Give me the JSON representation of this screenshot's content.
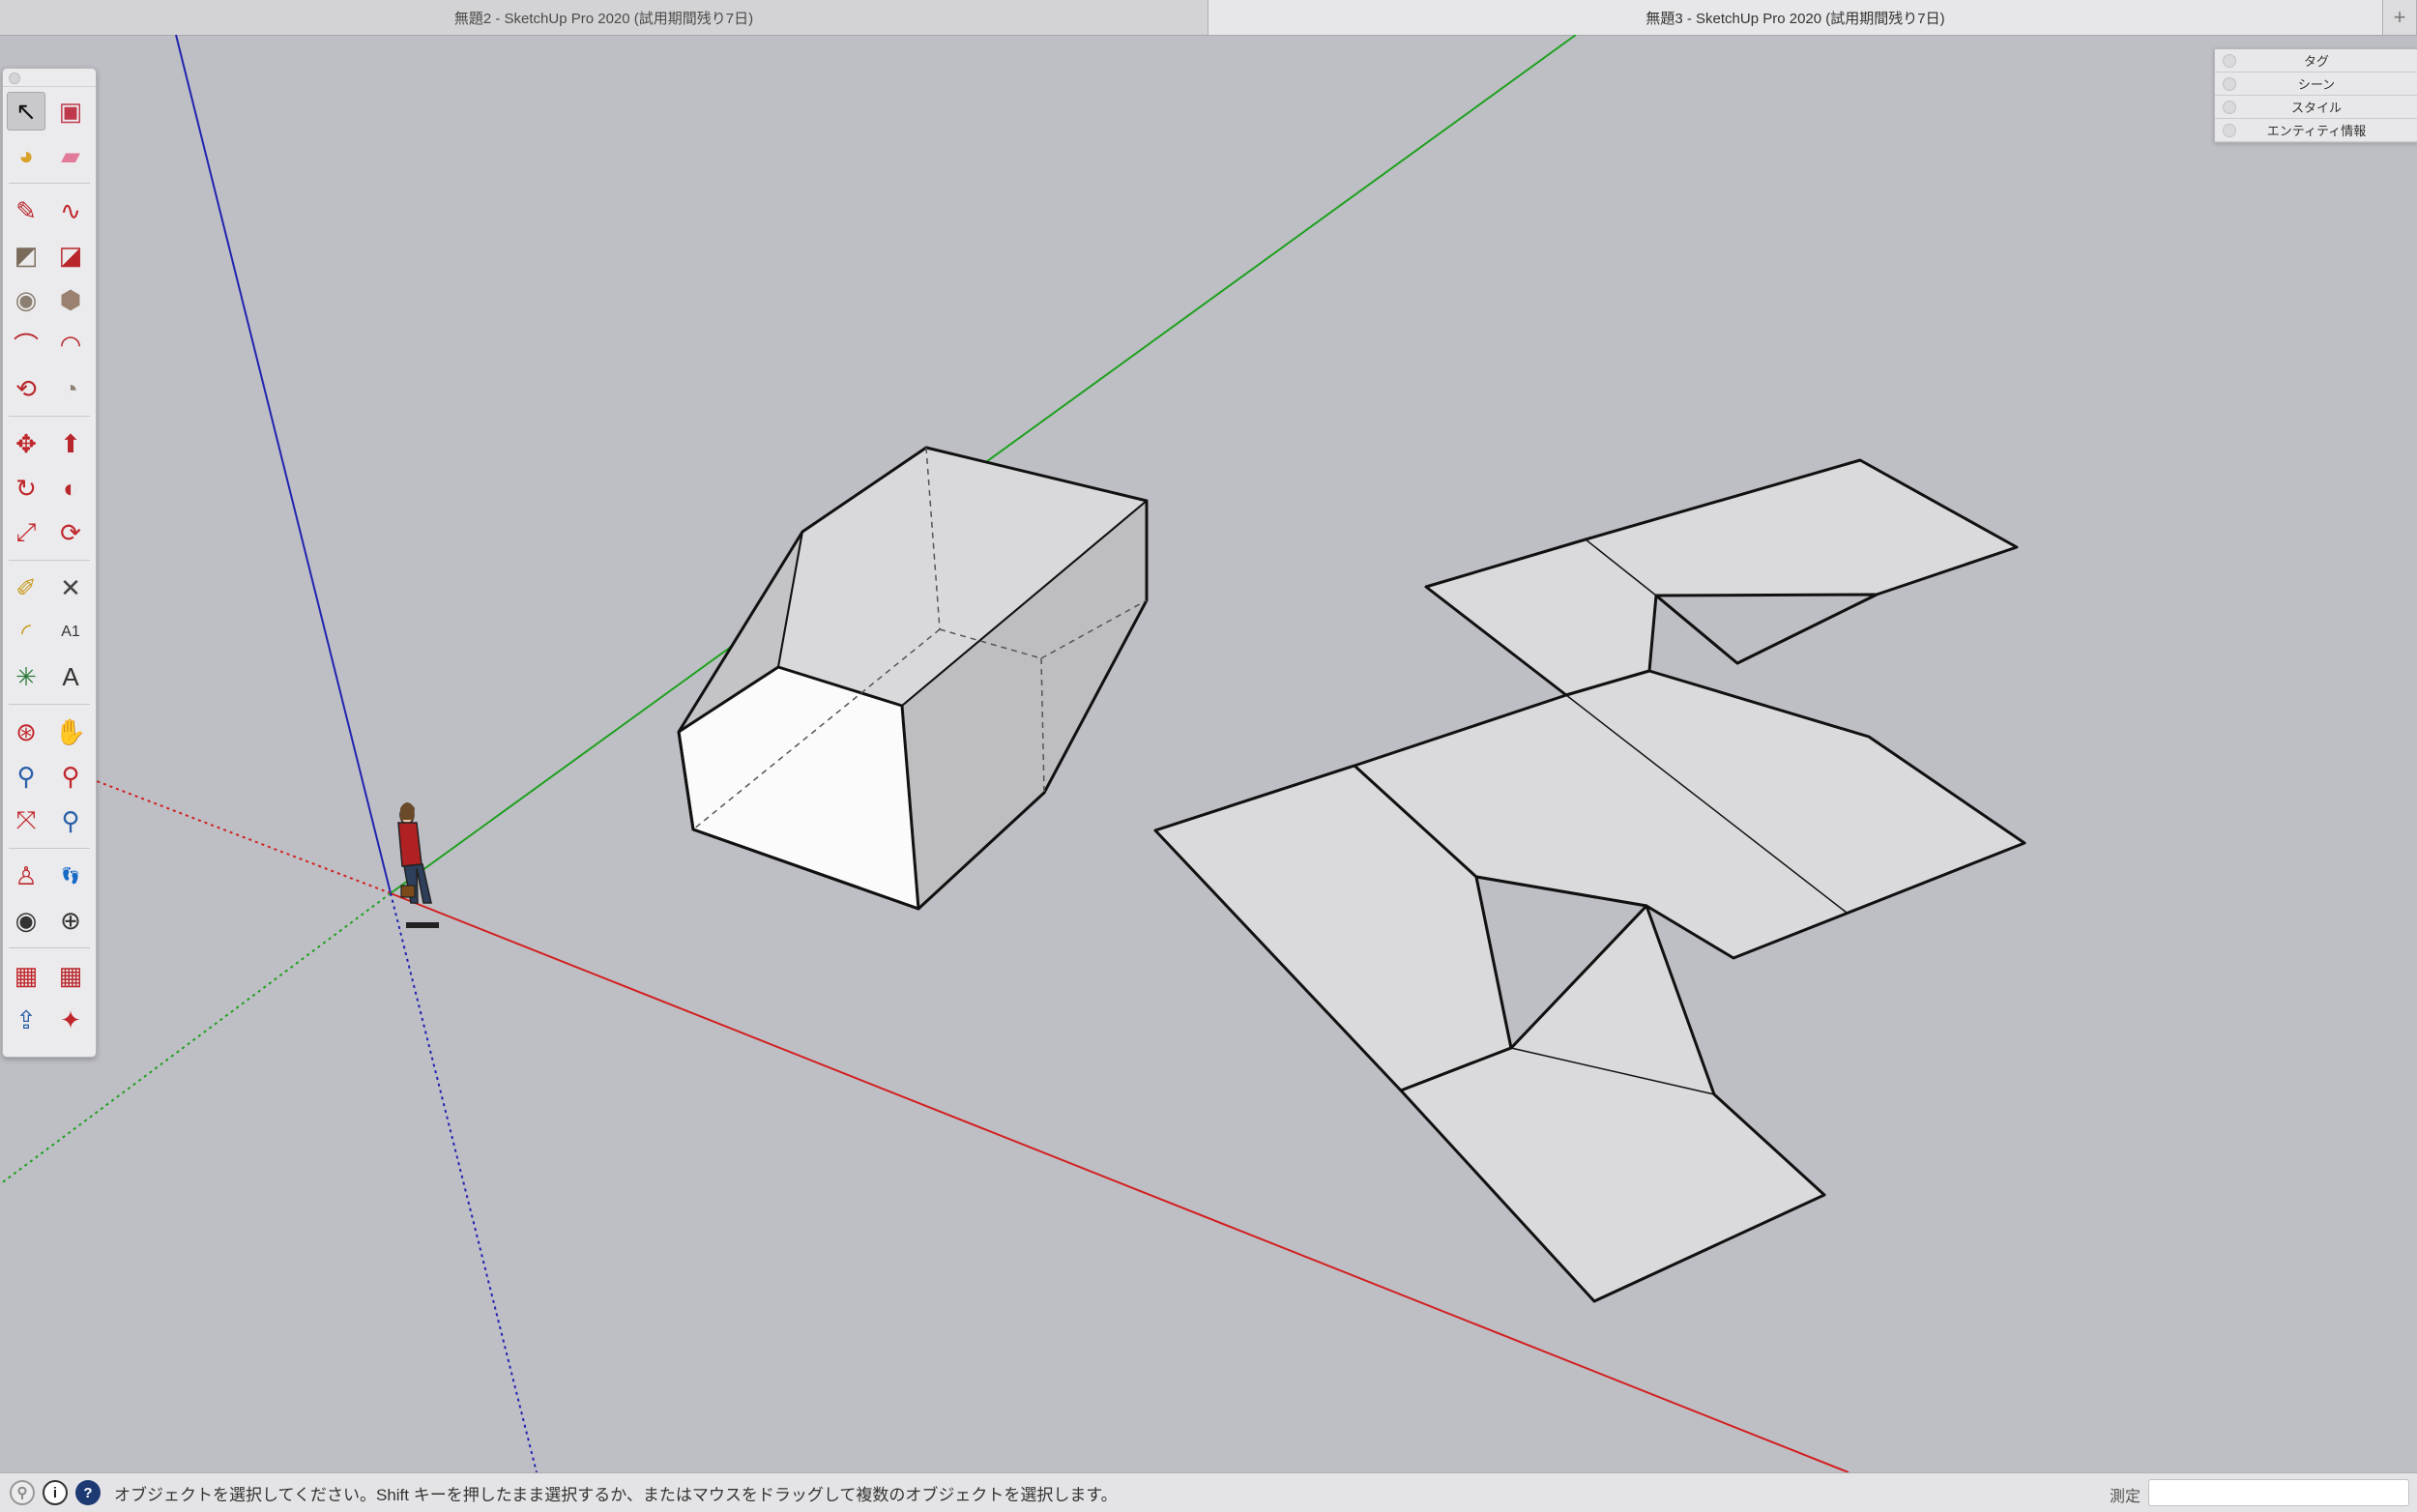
{
  "tabs": [
    {
      "title": "無題2 - SketchUp Pro 2020 (試用期間残り7日)"
    },
    {
      "title": "無題3 - SketchUp Pro 2020 (試用期間残り7日)"
    }
  ],
  "add_tab": "+",
  "tray": {
    "items": [
      {
        "label": "タグ"
      },
      {
        "label": "シーン"
      },
      {
        "label": "スタイル"
      },
      {
        "label": "エンティティ情報"
      }
    ]
  },
  "toolbar": {
    "tools": [
      {
        "name": "select-tool",
        "glyph": "↖",
        "color": "#111111"
      },
      {
        "name": "make-component-tool",
        "glyph": "▣",
        "color": "#c0394b"
      },
      {
        "name": "paint-bucket-tool",
        "glyph": "◕",
        "color": "#d8a22a"
      },
      {
        "name": "eraser-tool",
        "glyph": "▰",
        "color": "#e27a9a"
      },
      {
        "name": "pencil-line-tool",
        "glyph": "✎",
        "color": "#b8262b"
      },
      {
        "name": "freehand-tool",
        "glyph": "∿",
        "color": "#c0262b"
      },
      {
        "name": "rectangle-tool",
        "glyph": "◩",
        "color": "#7a6a5a"
      },
      {
        "name": "rotated-rectangle-tool",
        "glyph": "◪",
        "color": "#b8262b"
      },
      {
        "name": "circle-tool",
        "glyph": "◉",
        "color": "#8a7f70"
      },
      {
        "name": "polygon-tool",
        "glyph": "⬢",
        "color": "#9b8270"
      },
      {
        "name": "arc-tool",
        "glyph": "⌒",
        "color": "#b8262b"
      },
      {
        "name": "two-point-arc-tool",
        "glyph": "◠",
        "color": "#b8262b"
      },
      {
        "name": "three-point-arc-tool",
        "glyph": "⟲",
        "color": "#b8262b"
      },
      {
        "name": "pie-tool",
        "glyph": "◔",
        "color": "#8a7f70"
      },
      {
        "name": "move-tool",
        "glyph": "✥",
        "color": "#c0262b"
      },
      {
        "name": "push-pull-tool",
        "glyph": "⬆",
        "color": "#b8262b"
      },
      {
        "name": "rotate-tool",
        "glyph": "↻",
        "color": "#c0262b"
      },
      {
        "name": "follow-me-tool",
        "glyph": "◐",
        "color": "#b8262b"
      },
      {
        "name": "scale-tool",
        "glyph": "⤢",
        "color": "#c0262b"
      },
      {
        "name": "offset-tool",
        "glyph": "⟳",
        "color": "#c0262b"
      },
      {
        "name": "tape-measure-tool",
        "glyph": "✐",
        "color": "#c79a1c"
      },
      {
        "name": "dimension-tool",
        "glyph": "✕",
        "color": "#444444"
      },
      {
        "name": "protractor-tool",
        "glyph": "◜",
        "color": "#c79a1c"
      },
      {
        "name": "text-tool",
        "glyph": "A1",
        "color": "#333333"
      },
      {
        "name": "axes-tool",
        "glyph": "✳",
        "color": "#2a7a3a"
      },
      {
        "name": "3d-text-tool",
        "glyph": "A",
        "color": "#333333"
      },
      {
        "name": "orbit-tool",
        "glyph": "⊛",
        "color": "#c0262b"
      },
      {
        "name": "pan-tool",
        "glyph": "✋",
        "color": "#d4a24a"
      },
      {
        "name": "zoom-tool",
        "glyph": "⚲",
        "color": "#2a5fa8"
      },
      {
        "name": "zoom-window-tool",
        "glyph": "⚲",
        "color": "#c0262b"
      },
      {
        "name": "zoom-extents-tool",
        "glyph": "⤧",
        "color": "#c0262b"
      },
      {
        "name": "previous-view-tool",
        "glyph": "⚲",
        "color": "#2a5fa8"
      },
      {
        "name": "position-camera-tool",
        "glyph": "♙",
        "color": "#c0262b"
      },
      {
        "name": "walk-tool",
        "glyph": "👣",
        "color": "#222222"
      },
      {
        "name": "look-around-tool",
        "glyph": "◉",
        "color": "#333333"
      },
      {
        "name": "section-plane-tool",
        "glyph": "⊕",
        "color": "#333333"
      },
      {
        "name": "3d-warehouse-tool",
        "glyph": "▦",
        "color": "#c0262b"
      },
      {
        "name": "extension-warehouse-tool",
        "glyph": "▦",
        "color": "#b8262b"
      },
      {
        "name": "share-model-tool",
        "glyph": "⇪",
        "color": "#2a5fa8"
      },
      {
        "name": "extension-manager-tool",
        "glyph": "✦",
        "color": "#c0262b"
      }
    ]
  },
  "status": {
    "text": "オブジェクトを選択してください。Shift キーを押したまま選択するか、またはマウスをドラッグして複数のオブジェクトを選択します。",
    "measure_label": "測定",
    "measure_value": "",
    "info_icon": "?",
    "credit_icon": "i"
  },
  "colors": {
    "background": "#bebfc5",
    "axis_red": "#d22020",
    "axis_green": "#1fa01f",
    "axis_blue": "#2222b0",
    "face_light": "#dadadc",
    "face_white": "#fafafa",
    "face_shadow": "#bdbdc0"
  }
}
